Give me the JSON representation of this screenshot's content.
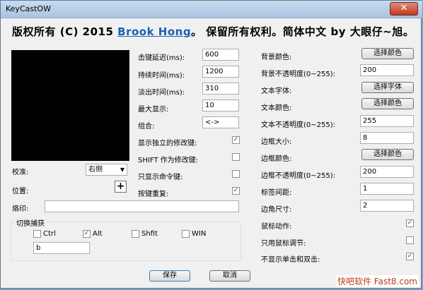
{
  "window": {
    "title": "KeyCastOW",
    "close_glyph": "✕"
  },
  "headline": {
    "prefix": "版权所有 (C) 2015 ",
    "author_link": "Brook Hong",
    "suffix": "。 保留所有权利。简体中文 by 大眼仔~旭。"
  },
  "left": {
    "alignment_label": "校准:",
    "alignment_value": "右侧",
    "position_label": "位置:",
    "plus_glyph": "+",
    "imprint_label": "烙印:",
    "imprint_value": ""
  },
  "middle": {
    "delay_label": "击键延迟(ms):",
    "delay_value": "600",
    "duration_label": "持续时间(ms):",
    "duration_value": "1200",
    "fadeout_label": "淡出时间(ms):",
    "fadeout_value": "310",
    "maxshow_label": "最大显示:",
    "maxshow_value": "10",
    "combo_label": "组合:",
    "combo_value": "<->",
    "show_mod_label": "显示独立的修改键:",
    "show_mod_checked": true,
    "shift_mod_label": "SHIFT 作为修改键:",
    "shift_mod_checked": false,
    "cmd_only_label": "只显示命令键:",
    "cmd_only_checked": false,
    "repeat_label": "按键重复:",
    "repeat_checked": true
  },
  "capture": {
    "title": "切换捕获",
    "ctrl": "Ctrl",
    "ctrl_checked": false,
    "alt": "Alt",
    "alt_checked": true,
    "shift": "Shfit",
    "shift_checked": false,
    "win": "WIN",
    "win_checked": false,
    "key_value": "b"
  },
  "right": {
    "bg_color_label": "背景颜色:",
    "bg_color_btn": "选择颜色",
    "bg_opacity_label": "背景不透明度(0~255):",
    "bg_opacity_value": "200",
    "font_label": "文本字体:",
    "font_btn": "选择字体",
    "text_color_label": "文本颜色:",
    "text_color_btn": "选择颜色",
    "text_opacity_label": "文本不透明度(0~255):",
    "text_opacity_value": "255",
    "border_size_label": "边框大小:",
    "border_size_value": "8",
    "border_color_label": "边框颜色:",
    "border_color_btn": "选择颜色",
    "border_opacity_label": "边框不透明度(0~255):",
    "border_opacity_value": "200",
    "tag_gap_label": "标签间距:",
    "tag_gap_value": "1",
    "corner_label": "边角尺寸:",
    "corner_value": "2",
    "mouse_action_label": "鼠标动作:",
    "mouse_action_checked": true,
    "mouse_adjust_label": "只用鼠标调节:",
    "mouse_adjust_checked": false,
    "no_click_label": "不显示单击和双击:",
    "no_click_checked": true
  },
  "buttons": {
    "save": "保存",
    "cancel": "取消"
  },
  "watermark": "快吧软件 Fast8.com",
  "colors": {
    "accent_link": "#1a5fb4",
    "check": "#2c4a7a"
  }
}
